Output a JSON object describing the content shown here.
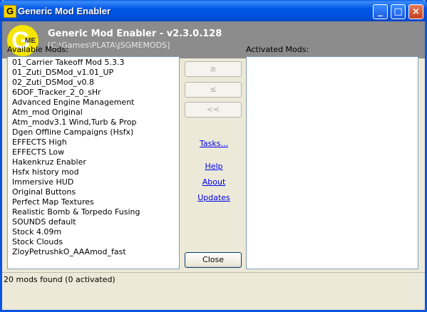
{
  "window": {
    "title": "Generic Mod Enabler",
    "app_icon_letter": "G"
  },
  "header": {
    "title": "Generic Mod Enabler - v2.3.0.128",
    "path": "[C:\\Games\\PLATA\\JSGMEMODS]",
    "logo_letter": "G",
    "logo_sub": "ME"
  },
  "available": {
    "label": "Available Mods:",
    "items": [
      "01_Carrier Takeoff Mod 5.3.3",
      "01_Zuti_DSMod_v1.01_UP",
      "02_Zuti_DSMod_v0.8",
      "6DOF_Tracker_2_0_sHr",
      "Advanced Engine Management",
      "Atm_mod Original",
      "Atm_modv3.1 Wind,Turb & Prop",
      "Dgen Offline Campaigns (Hsfx)",
      "EFFECTS High",
      "EFFECTS Low",
      "Hakenkruz Enabler",
      "Hsfx history mod",
      "Immersive HUD",
      "Original Buttons",
      "Perfect Map Textures",
      "Realistic Bomb & Torpedo Fusing",
      "SOUNDS default",
      "Stock 4.09m",
      "Stock Clouds",
      "ZloyPetrushkO_AAAmod_fast"
    ]
  },
  "activated": {
    "label": "Activated Mods:",
    "items": []
  },
  "buttons": {
    "activate": "≥",
    "deactivate": "≤",
    "deactivate_all": "<<",
    "close": "Close"
  },
  "links": {
    "tasks": "Tasks...",
    "help": "Help",
    "about": "About",
    "updates": "Updates"
  },
  "status": "20 mods found (0 activated)"
}
